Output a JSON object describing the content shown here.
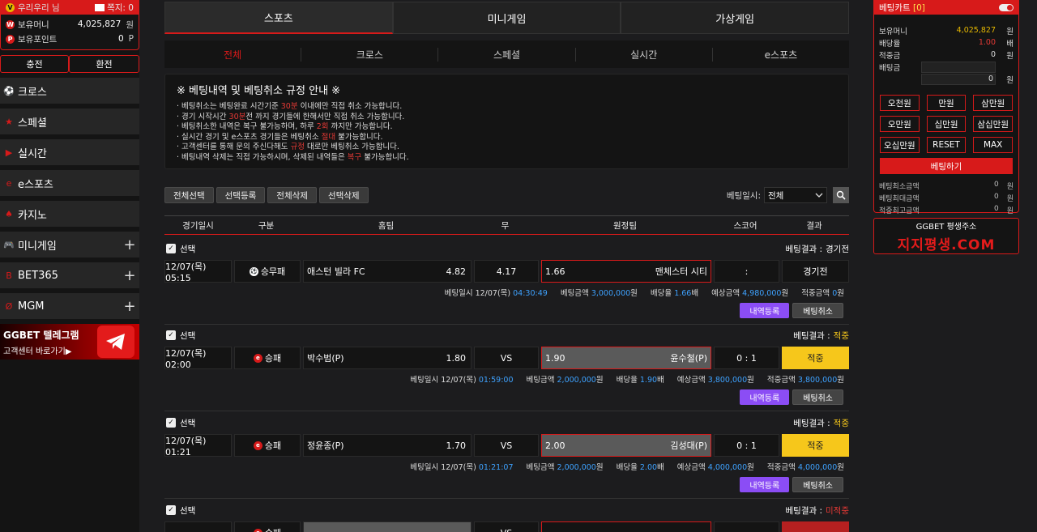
{
  "user": {
    "name": "우리우리 님",
    "message_label": "쪽지: 0",
    "money_label": "보유머니",
    "money": "4,025,827",
    "money_unit": "원",
    "point_label": "보유포인트",
    "point": "0",
    "point_unit": "P",
    "deposit": "충전",
    "withdraw": "환전"
  },
  "menu": [
    {
      "label": "크로스",
      "icon": "soccer-icon",
      "plus": false
    },
    {
      "label": "스페셜",
      "icon": "special-icon",
      "plus": false
    },
    {
      "label": "실시간",
      "icon": "live-icon",
      "plus": false
    },
    {
      "label": "e스포츠",
      "icon": "esports-icon",
      "plus": false
    },
    {
      "label": "카지노",
      "icon": "casino-icon",
      "plus": false
    },
    {
      "label": "미니게임",
      "icon": "gamepad-icon",
      "plus": true
    },
    {
      "label": "BET365",
      "icon": "bet365-icon",
      "plus": true
    },
    {
      "label": "MGM",
      "icon": "mgm-icon",
      "plus": true
    }
  ],
  "telegram": {
    "line1": "GGBET 텔레그램",
    "line2": "고객센터 바로가기▶"
  },
  "tabs": [
    "스포츠",
    "미니게임",
    "가상게임"
  ],
  "subtabs": [
    "전체",
    "크로스",
    "스페셜",
    "실시간",
    "e스포츠"
  ],
  "notice": {
    "title": "※ 베팅내역 및 베팅취소 규정 안내 ※",
    "lines": [
      [
        "· 베팅취소는 베팅완료 시간기준 ",
        "30분",
        " 이내에만 직접 취소 가능합니다."
      ],
      [
        "· 경기 시작시간 ",
        "30분",
        "전 까지 경기들에 한해서만 직접 취소 가능합니다."
      ],
      [
        "· 베팅취소한 내역은 복구 불가능하며, 하루 ",
        "2회",
        " 까지만 가능합니다."
      ],
      [
        "· 실시간 경기 및 e스포츠 경기들은 베팅취소 ",
        "절대",
        " 불가능합니다."
      ],
      [
        "· 고객센터를 통해 문의 주신다해도 ",
        "규정",
        " 대로만 베팅취소 가능합니다."
      ],
      [
        "· 베팅내역 삭제는 직접 가능하시며, 삭제된 내역들은 ",
        "복구",
        " 불가능합니다."
      ]
    ]
  },
  "toolbar": {
    "select_all": "전체선택",
    "select_register": "선택등록",
    "delete_all": "전체삭제",
    "select_delete": "선택삭제",
    "date_label": "베팅일시:",
    "date_value": "전체"
  },
  "columns": [
    "경기일시",
    "구분",
    "홈팀",
    "무",
    "원정팀",
    "스코어",
    "결과"
  ],
  "bets": [
    {
      "select": "선택",
      "result_label": "베팅결과 :",
      "result_text": "경기전",
      "result_color": "#ffffff",
      "date": "12/07(목) 05:15",
      "type": "승무패",
      "type_icon": "soccer-ball-icon",
      "home": "애스턴 빌라 FC",
      "home_odds": "4.82",
      "draw": "4.17",
      "away_odds": "1.66",
      "away": "맨체스터 시티",
      "score": ":",
      "result": "경기전",
      "result_state": "normal",
      "home_grey": false,
      "away_grey": false,
      "info": {
        "time_label": "베팅일시 12/07(목)",
        "time": "04:30:49",
        "amount_label": "베팅금액",
        "amount": "3,000,000",
        "amount_unit": "원",
        "odds_label": "배당율",
        "odds": "1.66",
        "odds_unit": "배",
        "expect_label": "예상금액",
        "expect": "4,980,000",
        "expect_unit": "원",
        "win_label": "적중금액",
        "win": "0",
        "win_unit": "원"
      },
      "btn_register": "내역등록",
      "btn_cancel": "베팅취소"
    },
    {
      "select": "선택",
      "result_label": "베팅결과 :",
      "result_text": "적중",
      "result_color": "#f6c71b",
      "date": "12/07(목) 02:00",
      "type": "승패",
      "type_icon": "esports-e-icon",
      "home": "박수범(P)",
      "home_odds": "1.80",
      "draw": "VS",
      "away_odds": "1.90",
      "away": "윤수철(P)",
      "score": "0 : 1",
      "result": "적중",
      "result_state": "win",
      "home_grey": false,
      "away_grey": true,
      "info": {
        "time_label": "베팅일시 12/07(목)",
        "time": "01:59:00",
        "amount_label": "베팅금액",
        "amount": "2,000,000",
        "amount_unit": "원",
        "odds_label": "배당율",
        "odds": "1.90",
        "odds_unit": "배",
        "expect_label": "예상금액",
        "expect": "3,800,000",
        "expect_unit": "원",
        "win_label": "적중금액",
        "win": "3,800,000",
        "win_unit": "원"
      },
      "btn_register": "내역등록",
      "btn_cancel": "베팅취소"
    },
    {
      "select": "선택",
      "result_label": "베팅결과 :",
      "result_text": "적중",
      "result_color": "#f6c71b",
      "date": "12/07(목) 01:21",
      "type": "승패",
      "type_icon": "esports-e-icon",
      "home": "정윤종(P)",
      "home_odds": "1.70",
      "draw": "VS",
      "away_odds": "2.00",
      "away": "김성대(P)",
      "score": "0 : 1",
      "result": "적중",
      "result_state": "win",
      "home_grey": false,
      "away_grey": true,
      "info": {
        "time_label": "베팅일시 12/07(목)",
        "time": "01:21:07",
        "amount_label": "베팅금액",
        "amount": "2,000,000",
        "amount_unit": "원",
        "odds_label": "배당율",
        "odds": "2.00",
        "odds_unit": "배",
        "expect_label": "예상금액",
        "expect": "4,000,000",
        "expect_unit": "원",
        "win_label": "적중금액",
        "win": "4,000,000",
        "win_unit": "원"
      },
      "btn_register": "내역등록",
      "btn_cancel": "베팅취소"
    },
    {
      "select": "선택",
      "result_label": "베팅결과 :",
      "result_text": "미적중",
      "result_color": "#e53935",
      "date": "",
      "type": "승패",
      "type_icon": "esports-e-icon",
      "home": "",
      "home_odds": "",
      "draw": "VS",
      "away_odds": "",
      "away": "",
      "score": "",
      "result": "",
      "result_state": "pending",
      "home_grey": true,
      "away_grey": false,
      "info": null
    }
  ],
  "cart": {
    "title": "베팅카트",
    "count": "[0]",
    "rows": [
      {
        "label": "보유머니",
        "value": "4,025,827",
        "unit": "원",
        "style": "gold"
      },
      {
        "label": "배당율",
        "value": "1.00",
        "unit": "배",
        "style": "red"
      },
      {
        "label": "적중금",
        "value": "0",
        "unit": "원",
        "style": ""
      },
      {
        "label": "배팅금",
        "value": "",
        "unit": "",
        "style": "input"
      },
      {
        "label": "",
        "value": "0",
        "unit": "원",
        "style": "input"
      }
    ],
    "amounts": [
      "오천원",
      "만원",
      "삼만원",
      "오만원",
      "십만원",
      "삼십만원",
      "오십만원",
      "RESET",
      "MAX"
    ],
    "bet_button": "베팅하기",
    "limits": [
      {
        "label": "베팅최소금액",
        "value": "0",
        "unit": "원"
      },
      {
        "label": "베팅최대금액",
        "value": "0",
        "unit": "원"
      },
      {
        "label": "적중최고금액",
        "value": "0",
        "unit": "원"
      }
    ]
  },
  "address": {
    "line1": "GGBET 평생주소",
    "line2": "지지평생.COM"
  }
}
